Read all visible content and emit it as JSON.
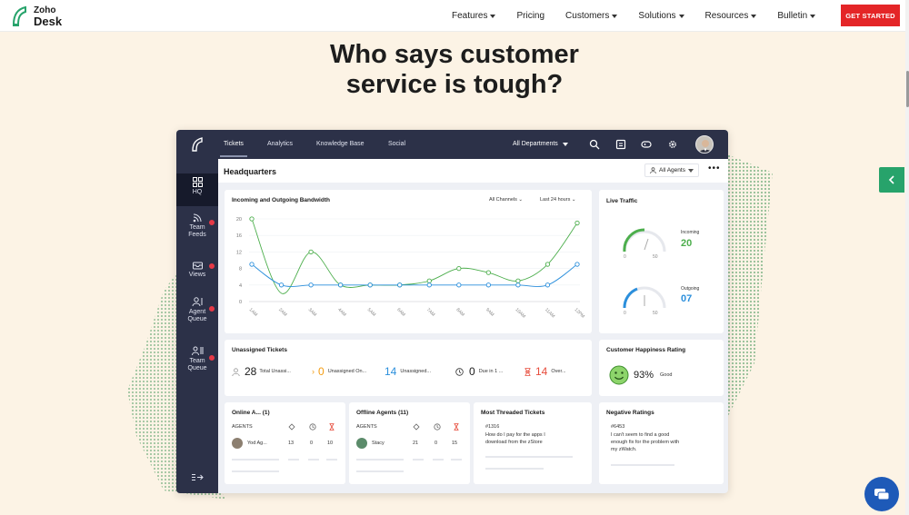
{
  "brand": {
    "line1": "Zoho",
    "line2": "Desk"
  },
  "nav": {
    "items": [
      {
        "label": "Features",
        "dropdown": true
      },
      {
        "label": "Pricing",
        "dropdown": false
      },
      {
        "label": "Customers",
        "dropdown": true
      },
      {
        "label": "Solutions",
        "dropdown": true
      },
      {
        "label": "Resources",
        "dropdown": true
      },
      {
        "label": "Bulletin",
        "dropdown": true
      }
    ],
    "cta": "GET STARTED"
  },
  "hero": {
    "line1": "Who says customer",
    "line2": "service is tough?"
  },
  "app": {
    "tabs": [
      "Tickets",
      "Analytics",
      "Knowledge Base",
      "Social"
    ],
    "department": "All Departments",
    "sidebar": [
      {
        "label": "HQ",
        "icon": "grid-icon"
      },
      {
        "label": "Team Feeds",
        "icon": "feed-icon"
      },
      {
        "label": "Views",
        "icon": "inbox-icon"
      },
      {
        "label": "Agent Queue",
        "icon": "agent-queue-icon"
      },
      {
        "label": "Team Queue",
        "icon": "team-queue-icon"
      }
    ],
    "page_title": "Headquarters",
    "agent_filter": "All Agents",
    "bandwidth": {
      "title": "Incoming and Outgoing Bandwidth",
      "filter1": "All Channels",
      "filter2": "Last 24 hours"
    },
    "live_traffic": {
      "title": "Live Traffic",
      "incoming_label": "Incoming",
      "incoming_value": "20",
      "outgoing_label": "Outgoing",
      "outgoing_value": "07",
      "gauge_min": "0",
      "gauge_max": "50"
    },
    "unassigned": {
      "title": "Unassigned Tickets",
      "stats": [
        {
          "value": "28",
          "label": "Total Unassi...",
          "color": "#1a1a1a"
        },
        {
          "value": "0",
          "label": "Unassigned On...",
          "color": "#f39c12"
        },
        {
          "value": "14",
          "label": "Unassigned...",
          "color": "#2b8fdc"
        },
        {
          "value": "0",
          "label": "Due in 1 ...",
          "color": "#1a1a1a"
        },
        {
          "value": "14",
          "label": "Over...",
          "color": "#e74c3c"
        }
      ]
    },
    "happiness": {
      "title": "Customer Happiness Rating",
      "value": "93%",
      "label": "Good"
    },
    "online_agents": {
      "title": "Online A... (1)",
      "col": "AGENTS",
      "agent": "Yod Ag...",
      "v1": "13",
      "v2": "0",
      "v3": "10"
    },
    "offline_agents": {
      "title": "Offline Agents (11)",
      "col": "AGENTS",
      "agent": "Stacy",
      "v1": "21",
      "v2": "0",
      "v3": "15"
    },
    "threaded": {
      "title": "Most Threaded Tickets",
      "id": "#1316",
      "text1": "How do I pay for the apps I",
      "text2": "download from the zStore"
    },
    "negative": {
      "title": "Negative Ratings",
      "id": "#6453",
      "text1": "I can't seem to find a good",
      "text2": "enough fix for the problem with",
      "text3": "my zWatch."
    }
  },
  "chart_data": {
    "type": "line",
    "title": "Incoming and Outgoing Bandwidth",
    "categories": [
      "1AM",
      "2AM",
      "3AM",
      "4AM",
      "5AM",
      "6AM",
      "7AM",
      "8AM",
      "9AM",
      "10AM",
      "11AM",
      "12PM"
    ],
    "yticks": [
      0,
      4,
      8,
      12,
      16,
      20
    ],
    "ylim": [
      0,
      20
    ],
    "series": [
      {
        "name": "Incoming",
        "color": "#4cae4c",
        "values": [
          20,
          2,
          12,
          4,
          4,
          4,
          5,
          8,
          7,
          5,
          9,
          19
        ]
      },
      {
        "name": "Outgoing",
        "color": "#2b8fdc",
        "values": [
          9,
          4,
          4,
          4,
          4,
          4,
          4,
          4,
          4,
          4,
          4,
          9
        ]
      }
    ]
  }
}
